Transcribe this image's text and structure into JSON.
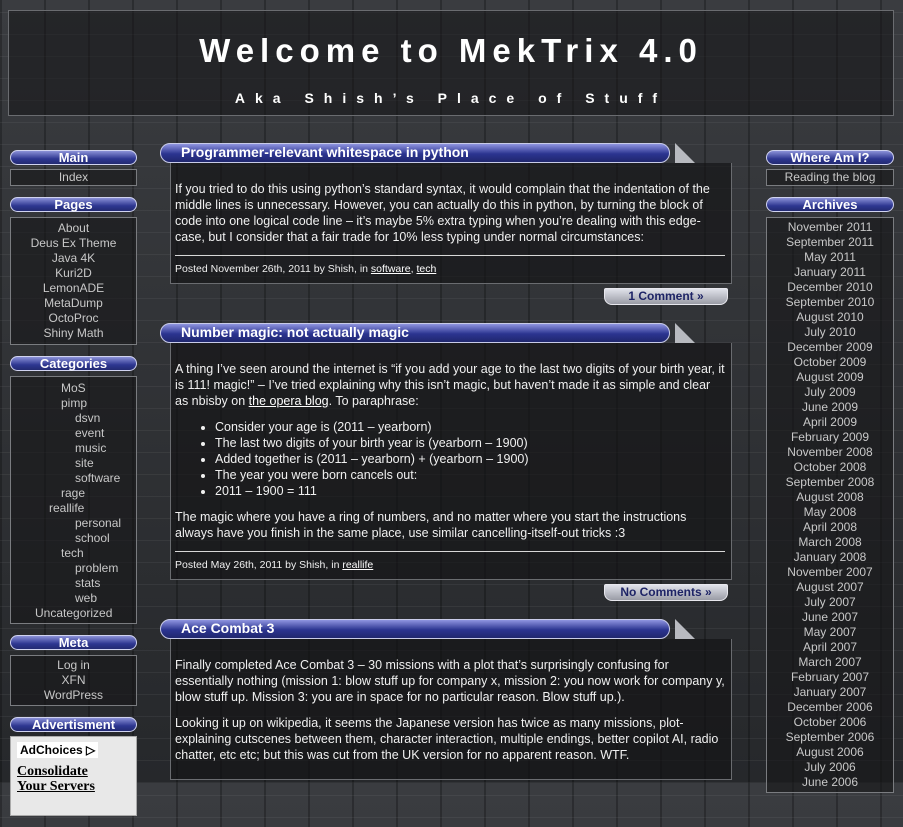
{
  "site": {
    "title": "Welcome to MekTrix 4.0",
    "tagline": "Aka Shish’s Place of Stuff"
  },
  "left": {
    "main": {
      "heading": "Main",
      "items": [
        "Index"
      ]
    },
    "pages": {
      "heading": "Pages",
      "items": [
        "About",
        "Deus Ex Theme",
        "Java 4K",
        "Kuri2D",
        "LemonADE",
        "MetaDump",
        "OctoProc",
        "Shiny Math"
      ]
    },
    "categories": {
      "heading": "Categories",
      "items": [
        "MoS",
        "pimp",
        "dsvn",
        "event",
        "music",
        "site",
        "software",
        "rage",
        "reallife",
        "personal",
        "school",
        "tech",
        "problem",
        "stats",
        "web",
        "Uncategorized"
      ]
    },
    "meta": {
      "heading": "Meta",
      "items": [
        "Log in",
        "XFN",
        "WordPress"
      ]
    },
    "ad": {
      "heading": "Advertisment",
      "adchoices": "AdChoices ▷",
      "link1": "Consolidate",
      "link2": "Your Servers"
    }
  },
  "right": {
    "where": {
      "heading": "Where Am I?",
      "text": "Reading the blog"
    },
    "archives": {
      "heading": "Archives",
      "items": [
        "November 2011",
        "September 2011",
        "May 2011",
        "January 2011",
        "December 2010",
        "September 2010",
        "August 2010",
        "July 2010",
        "December 2009",
        "October 2009",
        "August 2009",
        "July 2009",
        "June 2009",
        "April 2009",
        "February 2009",
        "November 2008",
        "October 2008",
        "September 2008",
        "August 2008",
        "May 2008",
        "April 2008",
        "March 2008",
        "January 2008",
        "November 2007",
        "August 2007",
        "July 2007",
        "June 2007",
        "May 2007",
        "April 2007",
        "March 2007",
        "February 2007",
        "January 2007",
        "December 2006",
        "October 2006",
        "September 2006",
        "August 2006",
        "July 2006",
        "June 2006"
      ]
    }
  },
  "posts": [
    {
      "title": "Programmer-relevant whitespace in python",
      "p1": "If you tried to do this using python’s standard syntax, it would complain that the indentation of the middle lines is unnecessary. However, you can actually do this in python, by turning the block of code into one logical code line – it’s maybe 5% extra typing when you’re dealing with this edge-case, but I consider that a fair trade for 10% less typing under normal circumstances:",
      "meta_prefix": "Posted November 26th, 2011 by Shish, in ",
      "cat1": "software",
      "sep": ", ",
      "cat2": "tech",
      "comments": "1 Comment »"
    },
    {
      "title": "Number magic: not actually magic",
      "p1_a": "A thing I’ve seen around the internet is “if you add your age to the last two digits of your birth year, it is 111! magic!” – I’ve tried explaining why this isn’t magic, but haven’t made it as simple and clear as nbisby on ",
      "p1_link": "the opera blog",
      "p1_b": ". To paraphrase:",
      "bullets": [
        "Consider your age is (2011 – yearborn)",
        "The last two digits of your birth year is (yearborn – 1900)",
        "Added together is (2011 – yearborn) + (yearborn – 1900)",
        "The year you were born cancels out:",
        "2011 – 1900 = 111"
      ],
      "p2": "The magic where you have a ring of numbers, and no matter where you start the instructions always have you finish in the same place, use similar cancelling-itself-out tricks :3",
      "meta_prefix": "Posted May 26th, 2011 by Shish, in ",
      "cat1": "reallife",
      "comments": "No Comments »"
    },
    {
      "title": "Ace Combat 3",
      "p1": "Finally completed Ace Combat 3 – 30 missions with a plot that’s surprisingly confusing for essentially nothing (mission 1: blow stuff up for company x, mission 2: you now work for company y, blow stuff up. Mission 3: you are in space for no particular reason. Blow stuff up.).",
      "p2": "Looking it up on wikipedia, it seems the Japanese version has twice as many missions, plot-explaining cutscenes between them, character interaction, multiple endings, better copilot AI, radio chatter, etc etc; but this was cut from the UK version for no apparent reason. WTF."
    }
  ]
}
